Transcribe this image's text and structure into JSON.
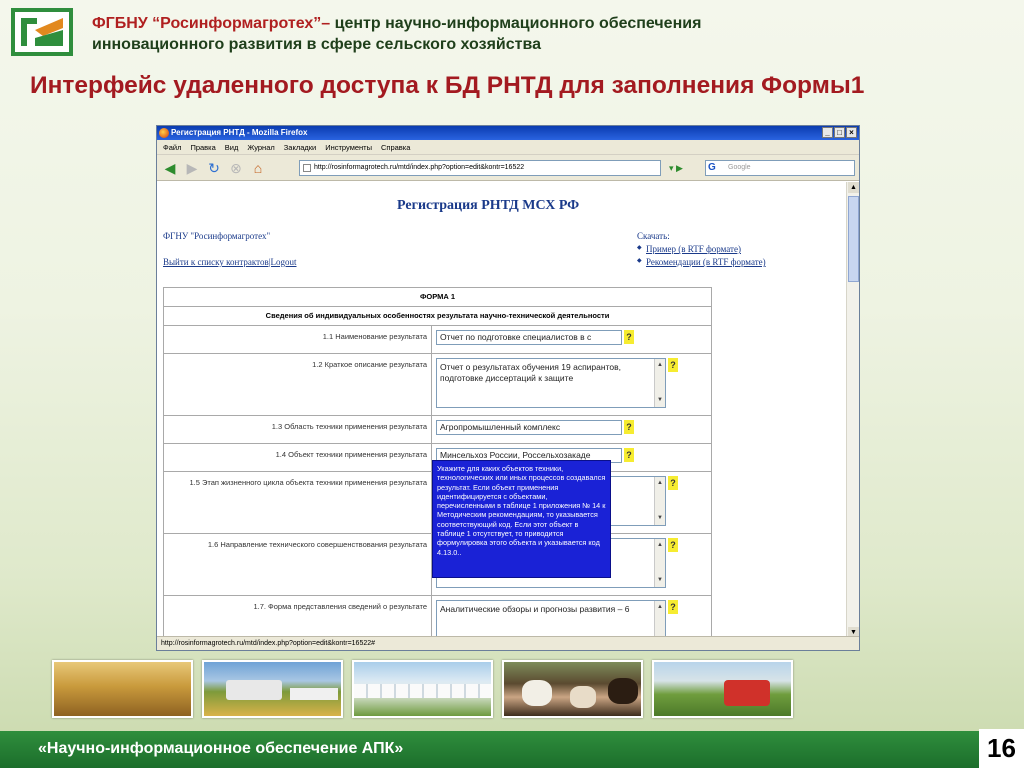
{
  "header": {
    "org_name": "ФГБНУ “Росинформагротех”–",
    "org_line1_rest": " центр научно-информационного обеспечения",
    "org_line2": "инновационного развития в сфере сельского хозяйства"
  },
  "slide_title": "Интерфейс удаленного доступа к БД РНТД для заполнения Формы1",
  "browser": {
    "window_title": "Регистрация РНТД - Mozilla Firefox",
    "menu": [
      "Файл",
      "Правка",
      "Вид",
      "Журнал",
      "Закладки",
      "Инструменты",
      "Справка"
    ],
    "url": "http://rosinformagrotech.ru/mtd/index.php?option=edit&kontr=16522",
    "search_placeholder": "Google",
    "status": "http://rosinformagrotech.ru/mtd/index.php?option=edit&kontr=16522#"
  },
  "page": {
    "title": "Регистрация РНТД МСХ РФ",
    "org": "ФГНУ \"Росинформагротех\"",
    "logout_link": "Выйти к списку контрактов|Logout",
    "download_label": "Скачать:",
    "download_links": [
      "Пример (в RTF формате)",
      "Рекомендации (в RTF формате)"
    ]
  },
  "form": {
    "title": "ФОРМА 1",
    "subtitle": "Сведения об индивидуальных особенностях результата научно-технической деятельности",
    "help_mark": "?",
    "rows": [
      {
        "label": "1.1 Наименование результата",
        "value": "Отчет по подготовке специалистов в с"
      },
      {
        "label": "1.2 Краткое описание результата",
        "value": "Отчет о результатах обучения 19 аспирантов, подготовке диссертаций к защите"
      },
      {
        "label": "1.3 Область техники применения результата",
        "value": "Агропромышленный комплекс"
      },
      {
        "label": "1.4 Объект техники применения результата",
        "value": "Минсельхоз России, Россельхозакаде"
      },
      {
        "label": "1.5 Этап жизненного цикла объекта техники применения результата",
        "value": ""
      },
      {
        "label": "1.6 Направление технического совершенствования результата",
        "value": ""
      },
      {
        "label": "1.7. Форма представления сведений о результате",
        "value": "Аналитические обзоры и прогнозы развития – 6"
      }
    ]
  },
  "tooltip": "Укажите для каких объектов техники, технологических или иных процессов создавался результат. Если объект применения идентифицируется с объектами, перечисленными в таблице 1 приложения № 14 к Методическим рекомендациям, то указывается соответствующий код. Если этот объект в таблице 1 отсутствует, то приводится формулировка этого объекта и указывается код 4.13.0..",
  "footer": {
    "text": "«Научно-информационное обеспечение АПК»",
    "page_number": "16"
  },
  "colors": {
    "title_red": "#a31a20",
    "footer_green": "#2f8e3d",
    "tooltip_blue": "#1a22d6",
    "help_yellow": "#f6ec31"
  }
}
